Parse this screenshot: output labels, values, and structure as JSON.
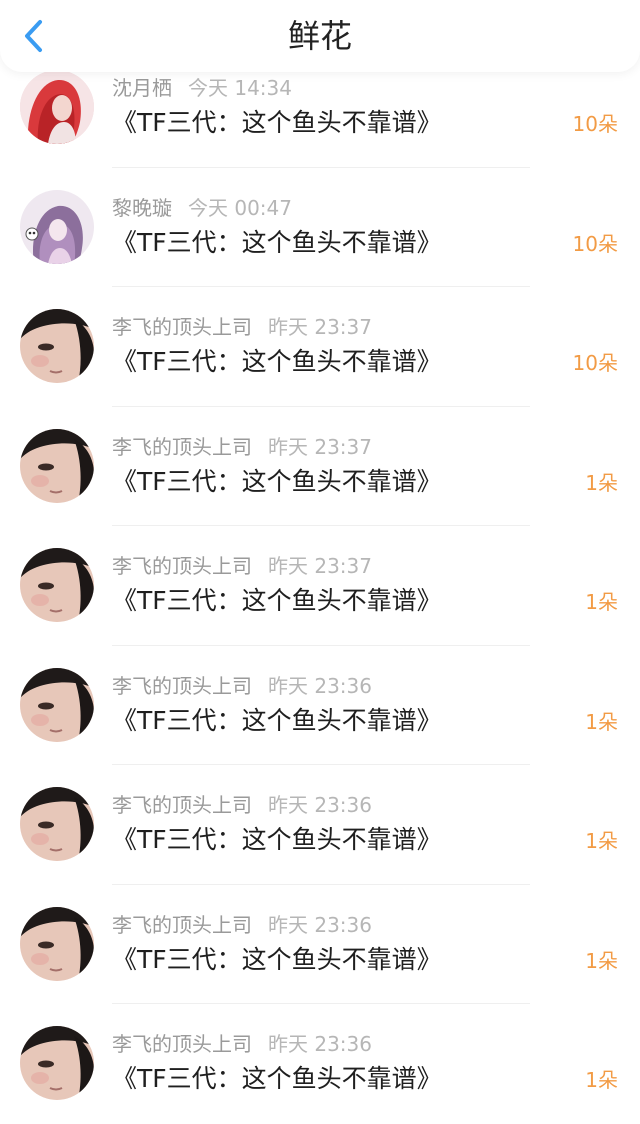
{
  "header": {
    "title": "鲜花",
    "back_icon": "chevron-left-icon",
    "accent": "#3a9cf2"
  },
  "records": [
    {
      "name": "沈月栖",
      "time": "今天 14:34",
      "book": "《TF三代：这个鱼头不靠谱》",
      "count": "10朵",
      "avatar": "avatar-red-hair"
    },
    {
      "name": "黎晚璇",
      "time": "今天 00:47",
      "book": "《TF三代：这个鱼头不靠谱》",
      "count": "10朵",
      "avatar": "avatar-purple-anime"
    },
    {
      "name": "李飞的顶头上司",
      "time": "昨天 23:37",
      "book": "《TF三代：这个鱼头不靠谱》",
      "count": "10朵",
      "avatar": "avatar-face-photo"
    },
    {
      "name": "李飞的顶头上司",
      "time": "昨天 23:37",
      "book": "《TF三代：这个鱼头不靠谱》",
      "count": "1朵",
      "avatar": "avatar-face-photo"
    },
    {
      "name": "李飞的顶头上司",
      "time": "昨天 23:37",
      "book": "《TF三代：这个鱼头不靠谱》",
      "count": "1朵",
      "avatar": "avatar-face-photo"
    },
    {
      "name": "李飞的顶头上司",
      "time": "昨天 23:36",
      "book": "《TF三代：这个鱼头不靠谱》",
      "count": "1朵",
      "avatar": "avatar-face-photo"
    },
    {
      "name": "李飞的顶头上司",
      "time": "昨天 23:36",
      "book": "《TF三代：这个鱼头不靠谱》",
      "count": "1朵",
      "avatar": "avatar-face-photo"
    },
    {
      "name": "李飞的顶头上司",
      "time": "昨天 23:36",
      "book": "《TF三代：这个鱼头不靠谱》",
      "count": "1朵",
      "avatar": "avatar-face-photo"
    },
    {
      "name": "李飞的顶头上司",
      "time": "昨天 23:36",
      "book": "《TF三代：这个鱼头不靠谱》",
      "count": "1朵",
      "avatar": "avatar-face-photo"
    }
  ],
  "colors": {
    "count": "#f29b45",
    "name": "#9a9a9a",
    "time": "#b6b6b6",
    "text": "#1f1f1f"
  }
}
